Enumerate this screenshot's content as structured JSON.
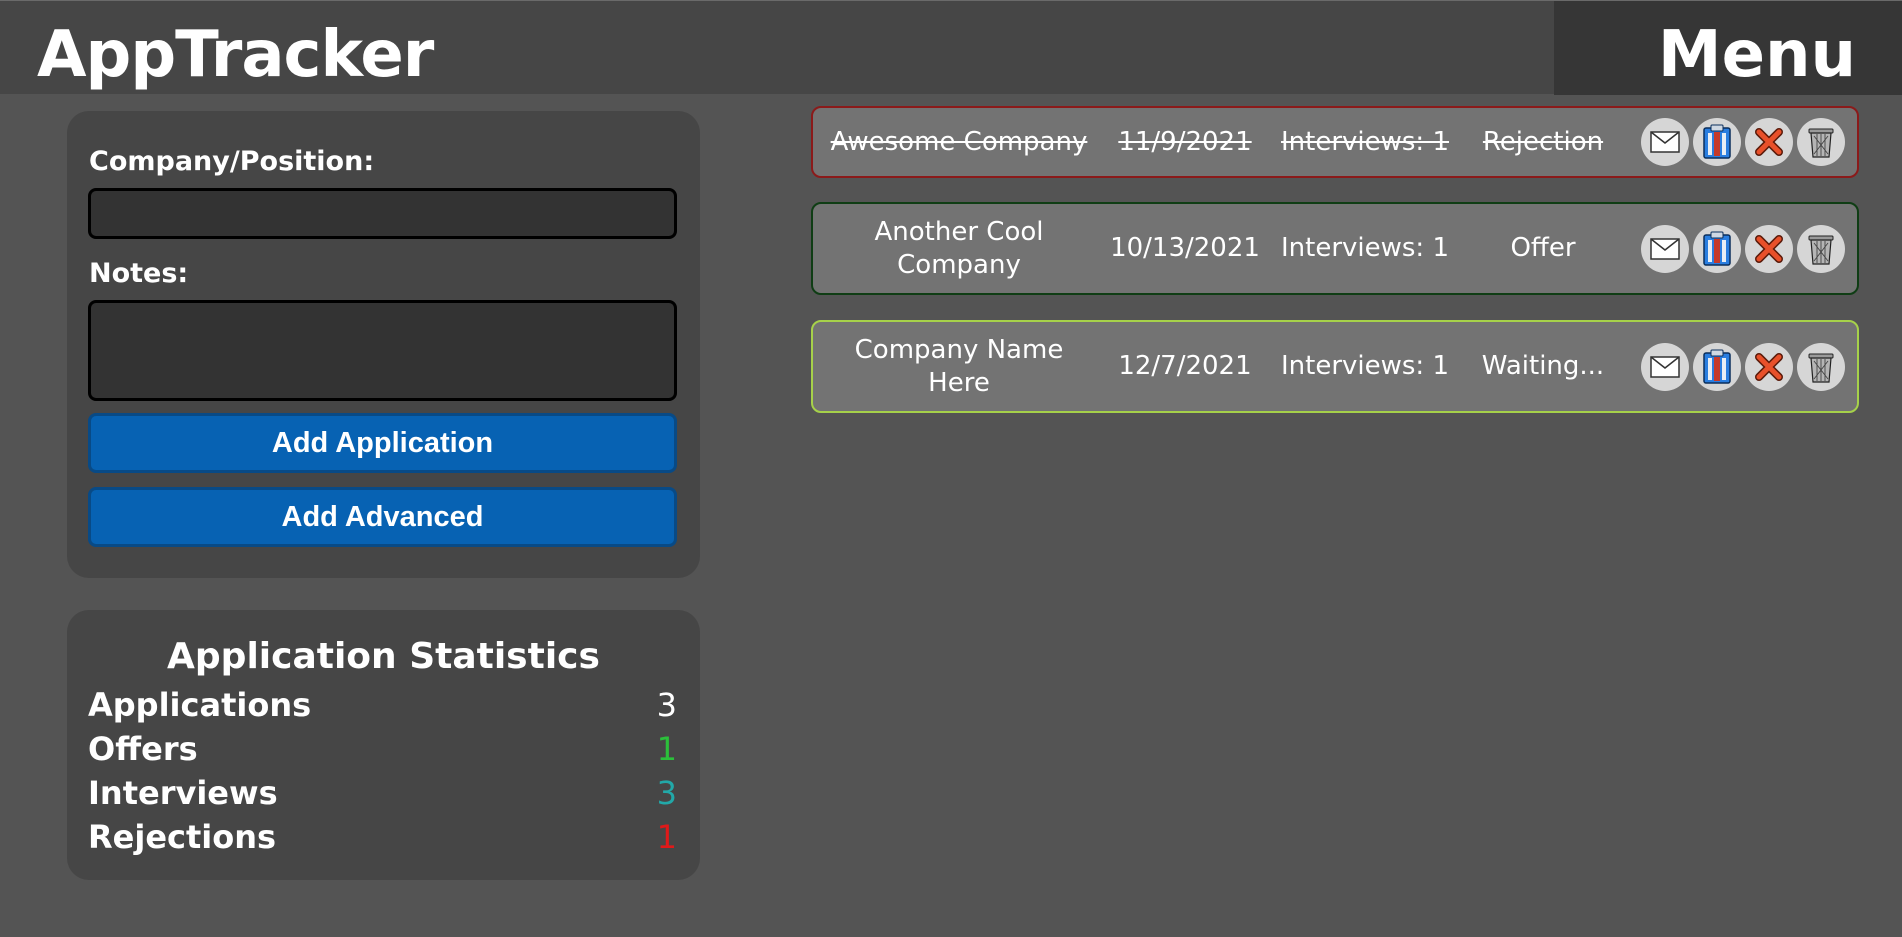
{
  "header": {
    "app_title": "AppTracker",
    "menu_label": "Menu"
  },
  "form": {
    "company_label": "Company/Position:",
    "company_value": "",
    "notes_label": "Notes:",
    "notes_value": "",
    "add_application_label": "Add Application",
    "add_advanced_label": "Add Advanced"
  },
  "stats": {
    "title": "Application Statistics",
    "rows": [
      {
        "label": "Applications",
        "value": "3",
        "color": "#ffffff"
      },
      {
        "label": "Offers",
        "value": "1",
        "color": "#2bbf3a"
      },
      {
        "label": "Interviews",
        "value": "3",
        "color": "#22a8a8"
      },
      {
        "label": "Rejections",
        "value": "1",
        "color": "#e01919"
      }
    ]
  },
  "applications": [
    {
      "company": "Awesome Company",
      "date": "11/9/2021",
      "interviews": "Interviews: 1",
      "status": "Rejection",
      "struck": true,
      "border_color": "#8b1a1a"
    },
    {
      "company": "Another Cool Company",
      "date": "10/13/2021",
      "interviews": "Interviews: 1",
      "status": "Offer",
      "struck": false,
      "border_color": "#0f3d14"
    },
    {
      "company": "Company Name Here",
      "date": "12/7/2021",
      "interviews": "Interviews: 1",
      "status": "Waiting...",
      "struck": false,
      "border_color": "#a6d14a"
    }
  ],
  "colors": {
    "background": "#545454",
    "panel": "#464646",
    "button": "#0762b3",
    "card": "#737373"
  },
  "icons": [
    "mail-icon",
    "clipboard-icon",
    "x-icon",
    "trash-icon"
  ]
}
